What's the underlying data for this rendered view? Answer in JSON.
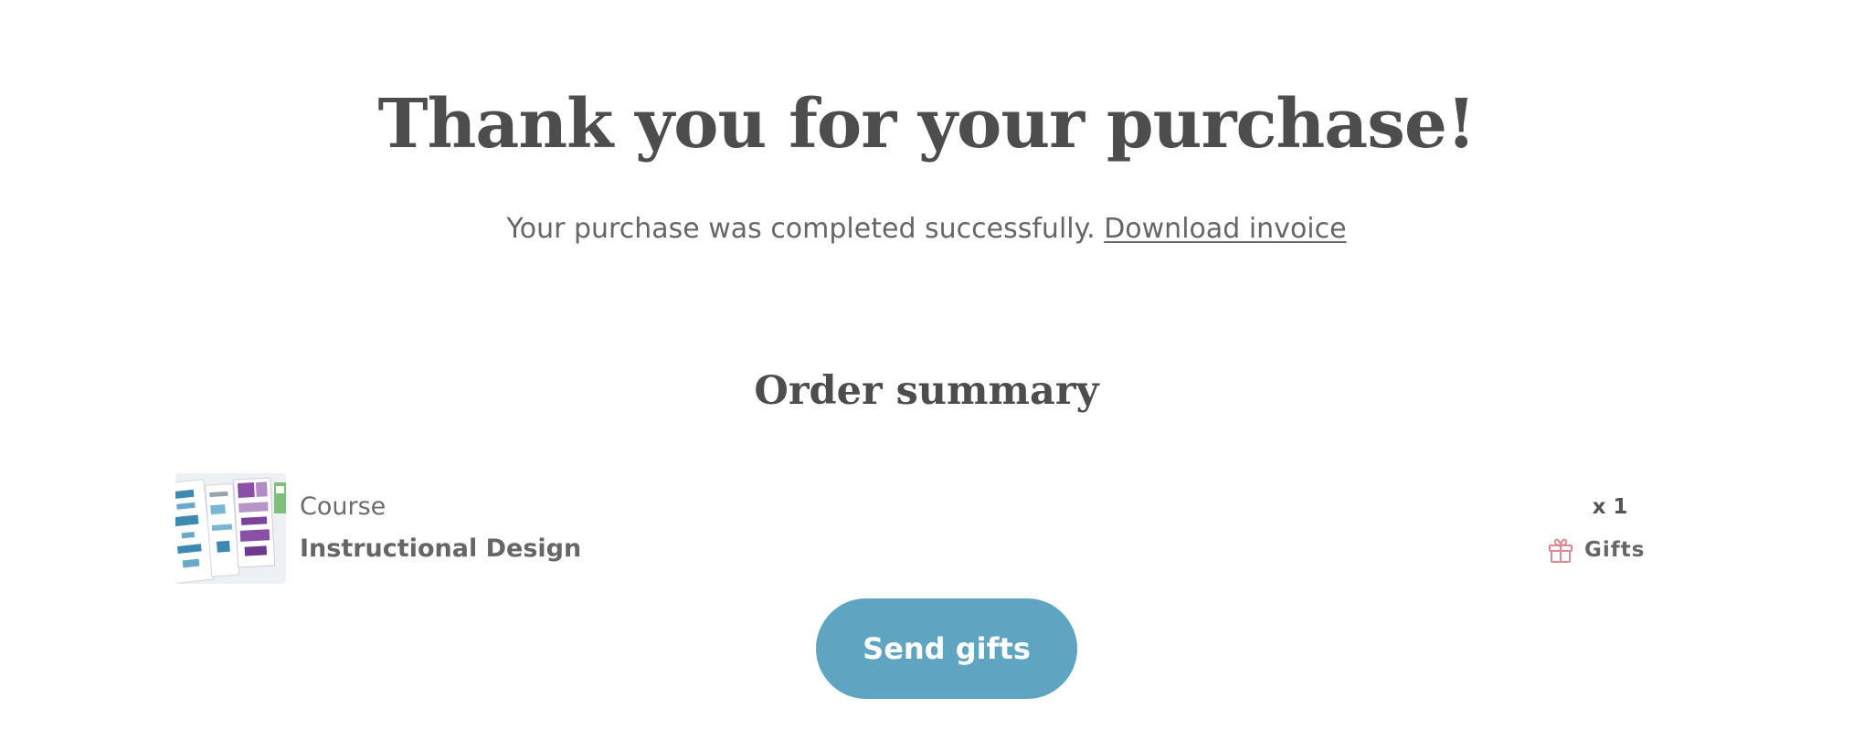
{
  "header": {
    "title": "Thank you for your purchase!",
    "message": "Your purchase was completed successfully.",
    "invoice_link": "Download invoice"
  },
  "summary": {
    "title": "Order summary",
    "items": [
      {
        "type": "Course",
        "name": "Instructional Design",
        "quantity": "x 1",
        "gifts_label": "Gifts",
        "gifts_icon": "gift-icon",
        "thumbnail": "course-thumbnail"
      }
    ]
  },
  "actions": {
    "send_gifts": "Send gifts"
  },
  "colors": {
    "button": "#5fa5c2",
    "gift_icon": "#d88a97",
    "heading": "#4d4d4d",
    "text": "#666666"
  }
}
